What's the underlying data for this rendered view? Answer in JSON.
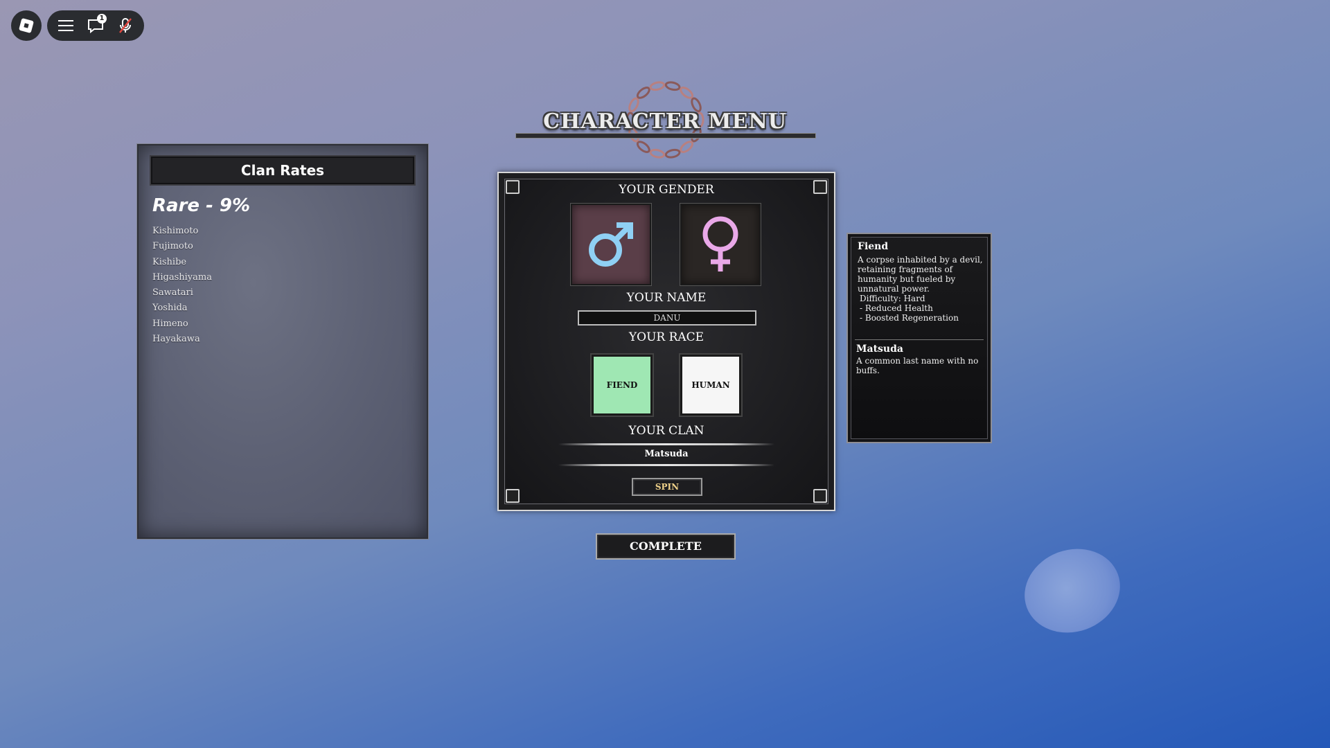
{
  "topbar": {
    "notification_count": "1",
    "icons": [
      "roblox-logo-icon",
      "menu-icon",
      "chat-icon",
      "mic-muted-icon"
    ]
  },
  "clan_rates": {
    "title": "Clan Rates",
    "tier": "Rare - 9%",
    "clans": [
      "Kishimoto",
      "Fujimoto",
      "Kishibe",
      "Higashiyama",
      "Sawatari",
      "Yoshida",
      "Himeno",
      "Hayakawa"
    ]
  },
  "menu": {
    "title": "CHARACTER MENU",
    "gender_label": "YOUR GENDER",
    "gender_selected": "male",
    "name_label": "YOUR NAME",
    "name_value": "DANU",
    "race_label": "YOUR RACE",
    "race_options": [
      "FIEND",
      "HUMAN"
    ],
    "race_selected": "FIEND",
    "clan_label": "YOUR CLAN",
    "clan_value": "Matsuda",
    "spin_label": "SPIN"
  },
  "complete_label": "COMPLETE",
  "info": {
    "race_title": "Fiend",
    "race_desc": "A corpse inhabited by a devil, retaining fragments of humanity but fueled by unnatural power.",
    "difficulty": "Difficulty: Hard",
    "traits": [
      "- Reduced Health",
      "- Boosted Regeneration"
    ],
    "clan_title": "Matsuda",
    "clan_desc": "A common last name with no buffs."
  },
  "colors": {
    "male_symbol": "#8fd0f4",
    "female_symbol": "#e9a8e8",
    "fiend_bg": "#9fe7b3",
    "spin_text": "#f0d28a"
  }
}
